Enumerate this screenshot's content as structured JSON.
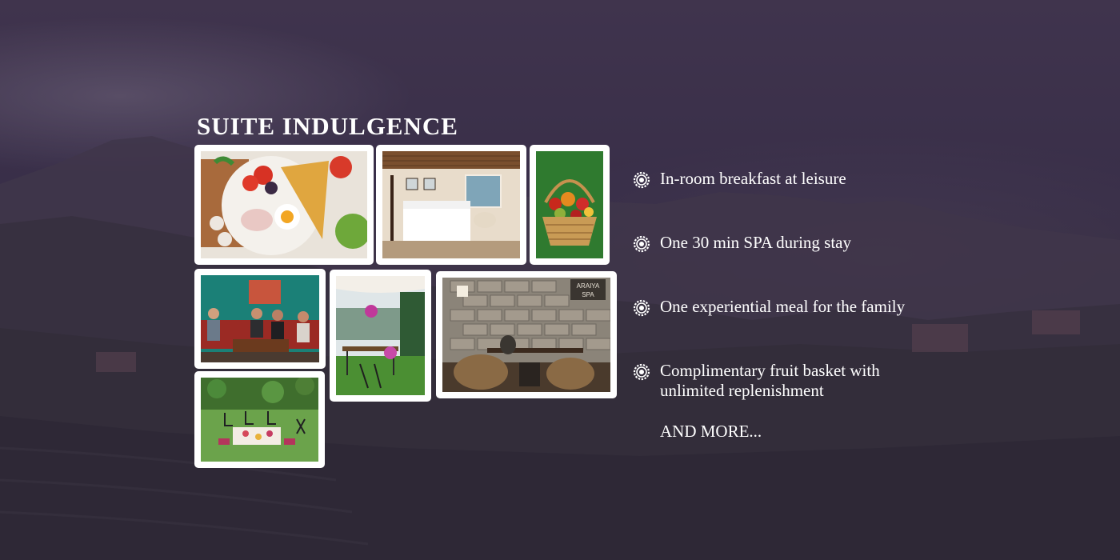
{
  "title": "SUITE INDULGENCE",
  "photos": [
    {
      "icon": "breakfast-photo"
    },
    {
      "icon": "suite-bedroom-photo"
    },
    {
      "icon": "fruit-basket-photo"
    },
    {
      "icon": "family-lounge-photo"
    },
    {
      "icon": "garden-dining-photo"
    },
    {
      "icon": "araiya-spa-photo",
      "sign": "ARAIYA\nSPA"
    },
    {
      "icon": "lawn-picnic-photo"
    }
  ],
  "features": [
    {
      "text": "In-room breakfast at leisure",
      "icon": "gear-bullet-icon"
    },
    {
      "text": "One 30 min SPA during stay",
      "icon": "gear-bullet-icon"
    },
    {
      "text": "One experiential meal for the family",
      "icon": "gear-bullet-icon"
    },
    {
      "text": "Complimentary fruit basket with\nunlimited replenishment",
      "icon": "gear-bullet-icon"
    }
  ],
  "more": "AND MORE...",
  "colors": {
    "background": "#3a3046",
    "text": "#ffffff",
    "frame": "#ffffff"
  }
}
